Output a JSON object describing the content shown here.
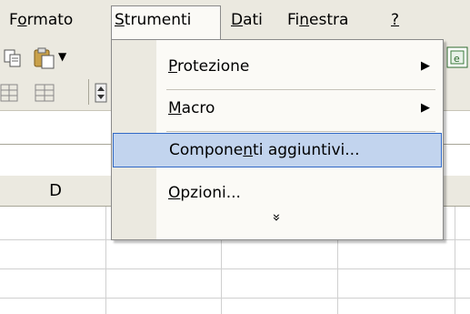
{
  "menubar": {
    "items": [
      {
        "pre": "F",
        "acc": "o",
        "post": "rmato"
      },
      {
        "pre": "",
        "acc": "S",
        "post": "trumenti"
      },
      {
        "pre": "",
        "acc": "D",
        "post": "ati"
      },
      {
        "pre": "Fi",
        "acc": "n",
        "post": "estra"
      },
      {
        "pre": "",
        "acc": "?",
        "post": ""
      }
    ]
  },
  "menu": {
    "items": [
      {
        "pre": "",
        "acc": "P",
        "post": "rotezione",
        "arrow": "▶"
      },
      {
        "pre": "",
        "acc": "M",
        "post": "acro",
        "arrow": "▶"
      },
      {
        "pre": "Compone",
        "acc": "n",
        "post": "ti aggiuntivi...",
        "arrow": ""
      },
      {
        "pre": "",
        "acc": "O",
        "post": "pzioni...",
        "arrow": ""
      }
    ],
    "expand_icon": "double-chevron-down-icon",
    "expand_glyph": "»"
  },
  "grid": {
    "column_header": "D"
  },
  "colors": {
    "menubar_bg": "#ebe9e0",
    "highlight": "#c2d4ee",
    "highlight_border": "#3169c6"
  }
}
